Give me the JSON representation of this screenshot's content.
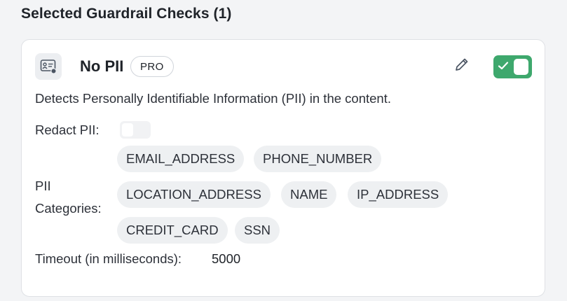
{
  "section": {
    "title": "Selected Guardrail Checks (1)"
  },
  "check": {
    "icon": "id-card-icon",
    "name": "No PII",
    "badge": "PRO",
    "edit_icon": "pencil-icon",
    "enabled": true,
    "description": "Detects Personally Identifiable Information (PII) in the content.",
    "redact_label": "Redact PII:",
    "redact_enabled": false,
    "categories_label_line1": "PII",
    "categories_label_line2": "Categories:",
    "categories": [
      "EMAIL_ADDRESS",
      "PHONE_NUMBER",
      "LOCATION_ADDRESS",
      "NAME",
      "IP_ADDRESS",
      "CREDIT_CARD",
      "SSN"
    ],
    "timeout_label": "Timeout (in milliseconds):",
    "timeout_value": "5000"
  },
  "colors": {
    "toggle_on": "#3ea86d",
    "chip_bg": "#eef0f2",
    "card_border": "#dfe1e5"
  }
}
